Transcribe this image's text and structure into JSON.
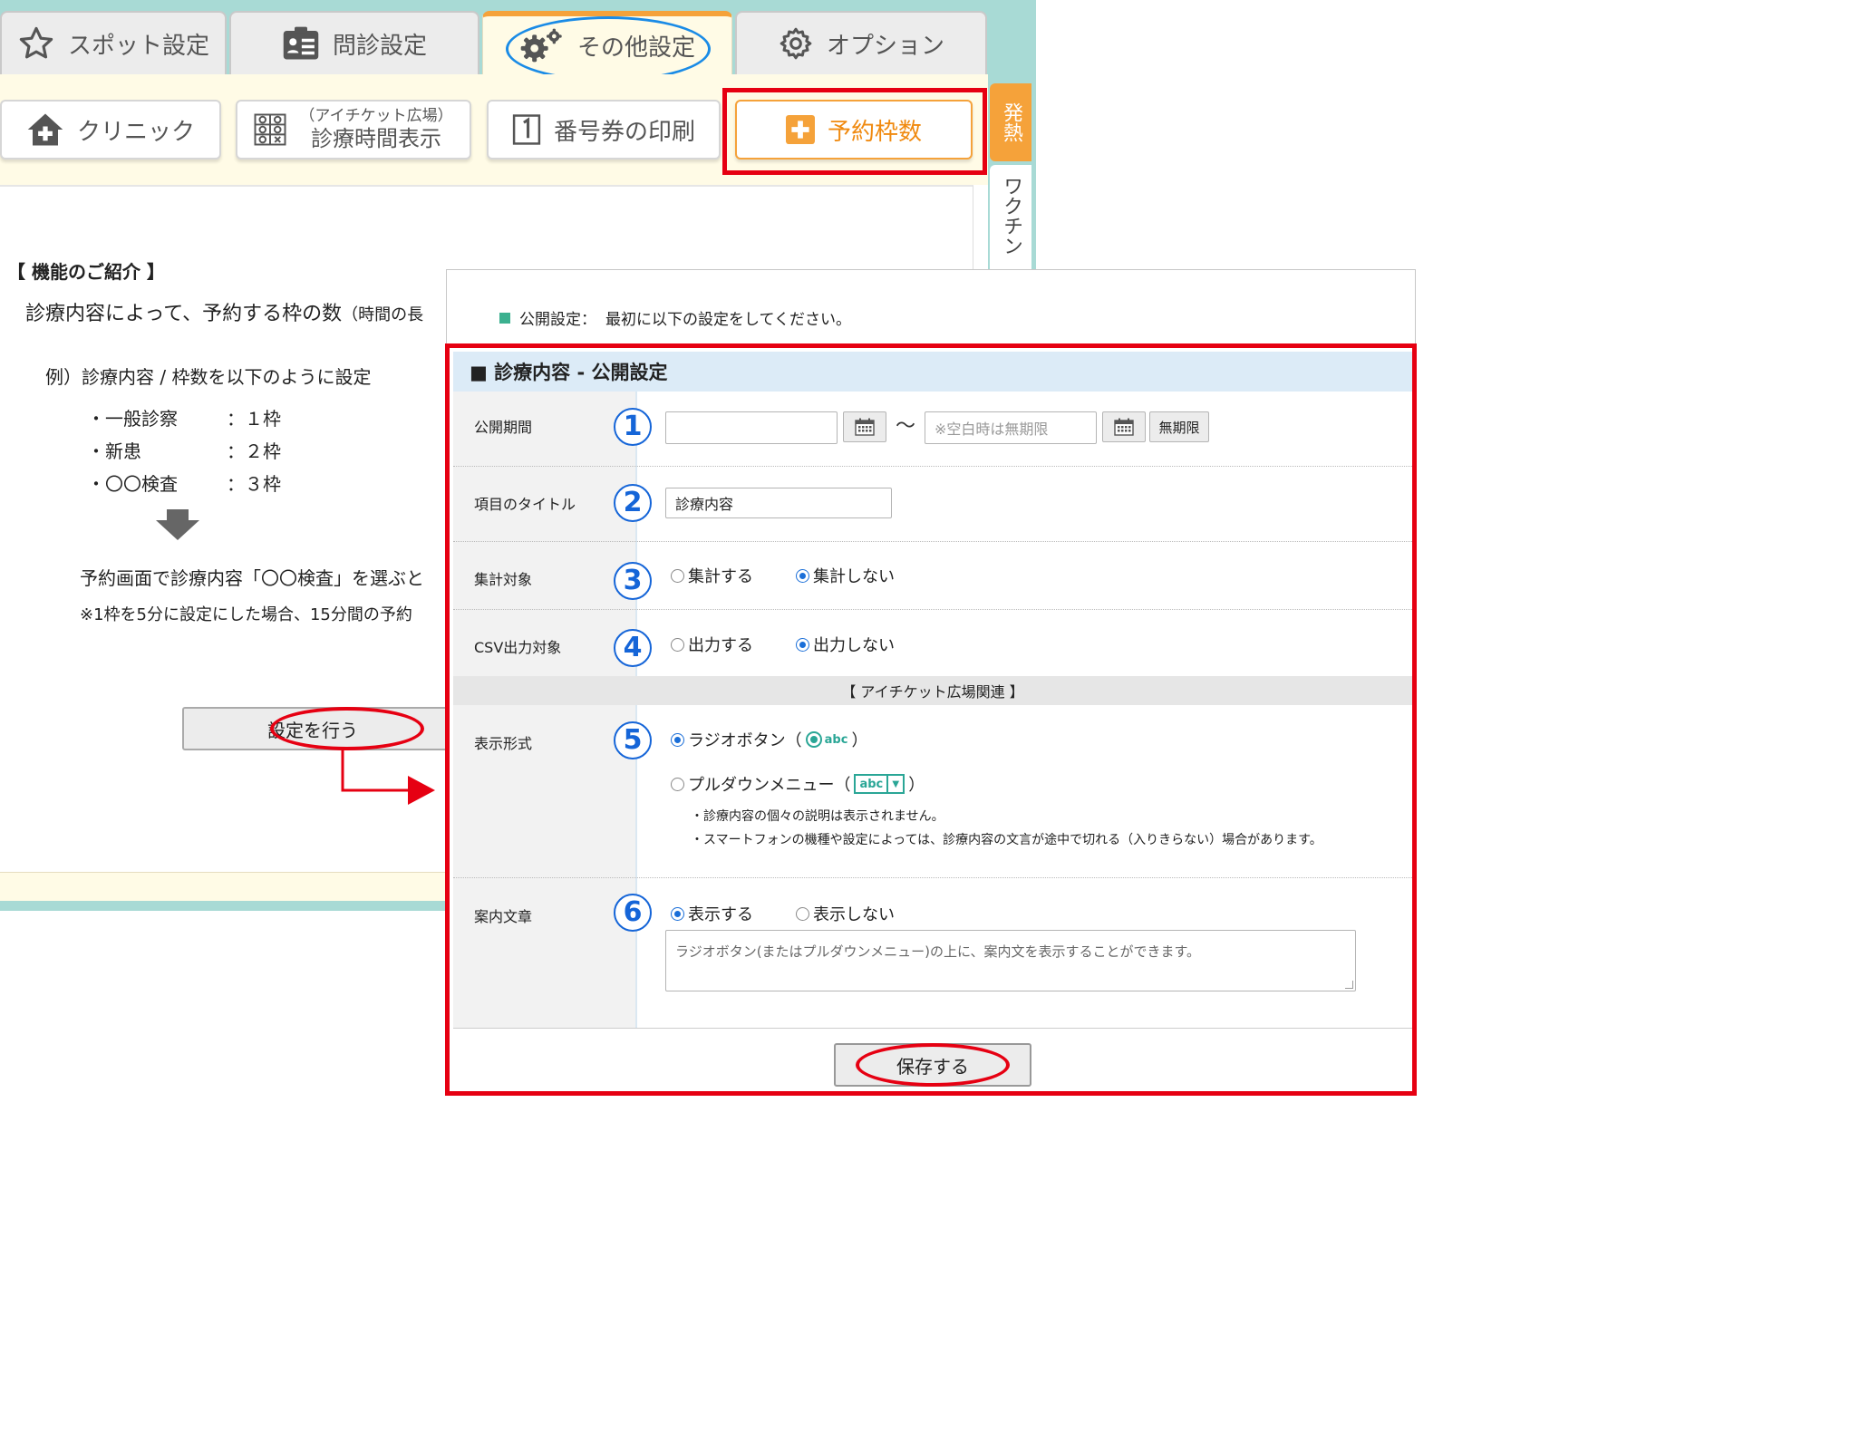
{
  "main_tabs": [
    {
      "label": "スポット設定",
      "icon": "star-icon"
    },
    {
      "label": "問診設定",
      "icon": "clipboard-icon"
    },
    {
      "label": "その他設定",
      "icon": "gears-icon",
      "active": true
    },
    {
      "label": "オプション",
      "icon": "gear-icon"
    }
  ],
  "sub_tabs": [
    {
      "label": "クリニック",
      "icon": "house-plus-icon"
    },
    {
      "label": "診療時間表示",
      "caption": "（アイチケット広場）",
      "icon": "grid-icon"
    },
    {
      "label": "番号券の印刷",
      "icon": "number-one-icon"
    },
    {
      "label": "予約枠数",
      "icon": "plus-square-icon",
      "active": true
    }
  ],
  "side_tabs": {
    "fever": "発熱",
    "vaccine": "ワクチン"
  },
  "intro": {
    "title": "【 機能のご紹介 】",
    "description": "診療内容によって、予約する枠の数",
    "description_paren": "（時間の長",
    "example_heading": "例）診療内容 / 枠数を以下のように設定",
    "examples": [
      {
        "item": "・一般診察",
        "value": "：１枠"
      },
      {
        "item": "・新患",
        "value": "：２枠"
      },
      {
        "item": "・〇〇検査",
        "value": "：３枠"
      }
    ],
    "result": "予約画面で診療内容「〇〇検査」を選ぶと",
    "note": "※1枠を5分に設定にした場合、15分間の予約",
    "setup_button": "設定を行う"
  },
  "dialog": {
    "notice_label": "公開設定：",
    "notice_text": "最初に以下の設定をしてください。",
    "section_title": "■ 診療内容 - 公開設定",
    "fields": {
      "period": {
        "label": "公開期間",
        "number": "1",
        "start_value": "",
        "end_placeholder": "※空白時は無期限",
        "unlimited_button": "無期限",
        "tilde": "〜"
      },
      "title": {
        "label": "項目のタイトル",
        "number": "2",
        "value": "診療内容"
      },
      "aggregate": {
        "label": "集計対象",
        "number": "3",
        "options": [
          "集計する",
          "集計しない"
        ],
        "selected": 1
      },
      "csv": {
        "label": "CSV出力対象",
        "number": "4",
        "options": [
          "出力する",
          "出力しない"
        ],
        "selected": 1
      },
      "related_heading": "【 アイチケット広場関連 】",
      "display": {
        "label": "表示形式",
        "number": "5",
        "option_radio": "ラジオボタン（",
        "option_pulldown": "プルダウンメニュー（",
        "close_paren": "）",
        "sample_text": "abc",
        "selected": 0,
        "notes": [
          "・診療内容の個々の説明は表示されません。",
          "・スマートフォンの機種や設定によっては、診療内容の文言が途中で切れる（入りきらない）場合があります。"
        ]
      },
      "guide": {
        "label": "案内文章",
        "number": "6",
        "options": [
          "表示する",
          "表示しない"
        ],
        "selected": 0,
        "placeholder": "ラジオボタン(またはプルダウンメニュー)の上に、案内文を表示することができます。"
      }
    },
    "save_button": "保存する"
  },
  "colors": {
    "accent_orange": "#f5a23a",
    "highlight_red": "#e60012",
    "number_blue": "#1565d8",
    "teal": "#a8dad5",
    "radio_blue": "#1a6ed8"
  }
}
